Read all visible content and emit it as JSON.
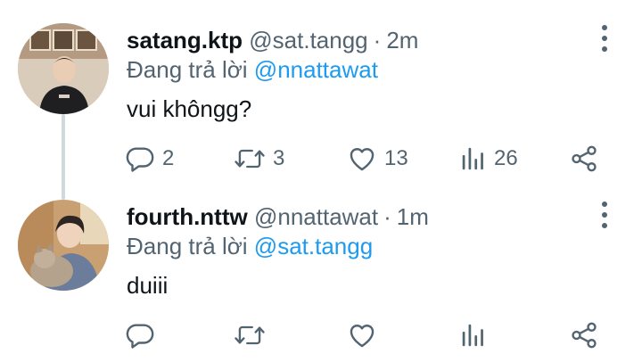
{
  "tweets": [
    {
      "display_name": "satang.ktp",
      "handle": "@sat.tangg",
      "separator": "·",
      "time": "2m",
      "replying_prefix": "Đang trả lời",
      "replying_to": "@nnattawat",
      "text": "vui khôngg?",
      "replies": "2",
      "retweets": "3",
      "likes": "13",
      "views": "26",
      "avatar_icon": "user-photo"
    },
    {
      "display_name": "fourth.nttw",
      "handle": "@nnattawat",
      "separator": "·",
      "time": "1m",
      "replying_prefix": "Đang trả lời",
      "replying_to": "@sat.tangg",
      "text": "duiii",
      "replies": "",
      "retweets": "",
      "likes": "",
      "views": "",
      "avatar_icon": "user-photo-with-cat"
    }
  ],
  "icons": {
    "reply": "reply-icon",
    "retweet": "retweet-icon",
    "like": "heart-icon",
    "views": "views-icon",
    "share": "share-icon",
    "more": "more-icon"
  },
  "colors": {
    "text": "#0f1419",
    "secondary": "#536471",
    "link": "#1d9bf0",
    "thread_line": "#cfd9de"
  }
}
